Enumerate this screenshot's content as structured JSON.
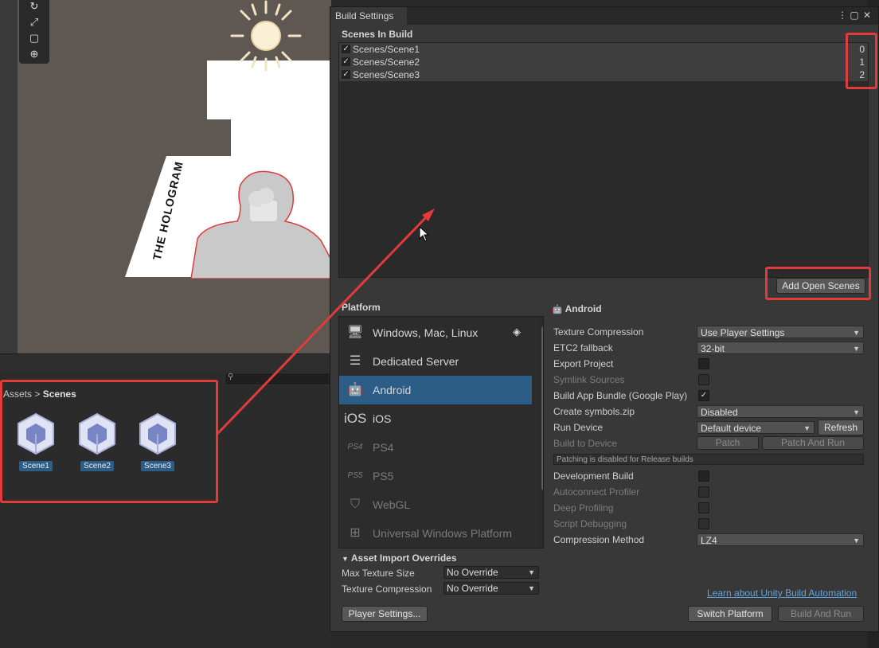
{
  "scene_view": {
    "hologram_text": "THE HOLOGRAM",
    "tool_icons": [
      "rotate-icon",
      "scale-icon",
      "rect-transform-icon",
      "transform-icon"
    ]
  },
  "project": {
    "breadcrumb_root": "Assets",
    "breadcrumb_sep": ">",
    "breadcrumb_current": "Scenes",
    "assets": [
      {
        "label": "Scene1"
      },
      {
        "label": "Scene2"
      },
      {
        "label": "Scene3"
      }
    ]
  },
  "build_settings": {
    "title": "Build Settings",
    "scenes_title": "Scenes In Build",
    "scenes": [
      {
        "name": "Scenes/Scene1",
        "index": "0",
        "checked": true
      },
      {
        "name": "Scenes/Scene2",
        "index": "1",
        "checked": true
      },
      {
        "name": "Scenes/Scene3",
        "index": "2",
        "checked": true
      }
    ],
    "add_open_scenes": "Add Open Scenes",
    "platform_title": "Platform",
    "platforms": [
      {
        "label": "Windows, Mac, Linux",
        "icon": "monitor-icon"
      },
      {
        "label": "Dedicated Server",
        "icon": "server-icon"
      },
      {
        "label": "Android",
        "icon": "android-icon",
        "selected": true
      },
      {
        "label": "iOS",
        "icon": "ios-icon",
        "icon_text": "iOS"
      },
      {
        "label": "PS4",
        "icon": "ps4-icon",
        "icon_text": "PS4"
      },
      {
        "label": "PS5",
        "icon": "ps5-icon",
        "icon_text": "PS5"
      },
      {
        "label": "WebGL",
        "icon": "html5-icon"
      },
      {
        "label": "Universal Windows Platform",
        "icon": "windows-icon"
      }
    ],
    "android": {
      "heading": "Android",
      "texture_compression_label": "Texture Compression",
      "texture_compression_value": "Use Player Settings",
      "etc2_label": "ETC2 fallback",
      "etc2_value": "32-bit",
      "export_project_label": "Export Project",
      "symlink_label": "Symlink Sources",
      "app_bundle_label": "Build App Bundle (Google Play)",
      "create_symbols_label": "Create symbols.zip",
      "create_symbols_value": "Disabled",
      "run_device_label": "Run Device",
      "run_device_value": "Default device",
      "refresh_label": "Refresh",
      "build_to_device_label": "Build to Device",
      "patch_label": "Patch",
      "patch_and_run_label": "Patch And Run",
      "patch_note": "Patching is disabled for Release builds",
      "dev_build_label": "Development Build",
      "autoconnect_label": "Autoconnect Profiler",
      "deep_profiling_label": "Deep Profiling",
      "script_debugging_label": "Script Debugging",
      "compression_label": "Compression Method",
      "compression_value": "LZ4"
    },
    "overrides": {
      "title": "Asset Import Overrides",
      "max_texture_label": "Max Texture Size",
      "max_texture_value": "No Override",
      "texture_comp_label": "Texture Compression",
      "texture_comp_value": "No Override"
    },
    "learn_link": "Learn about Unity Build Automation",
    "player_settings": "Player Settings...",
    "switch_platform": "Switch Platform",
    "build_and_run": "Build And Run"
  },
  "colors": {
    "annotation_red": "#e13b3b",
    "selection_blue": "#2c5d87",
    "link_blue": "#5fa3e0"
  }
}
